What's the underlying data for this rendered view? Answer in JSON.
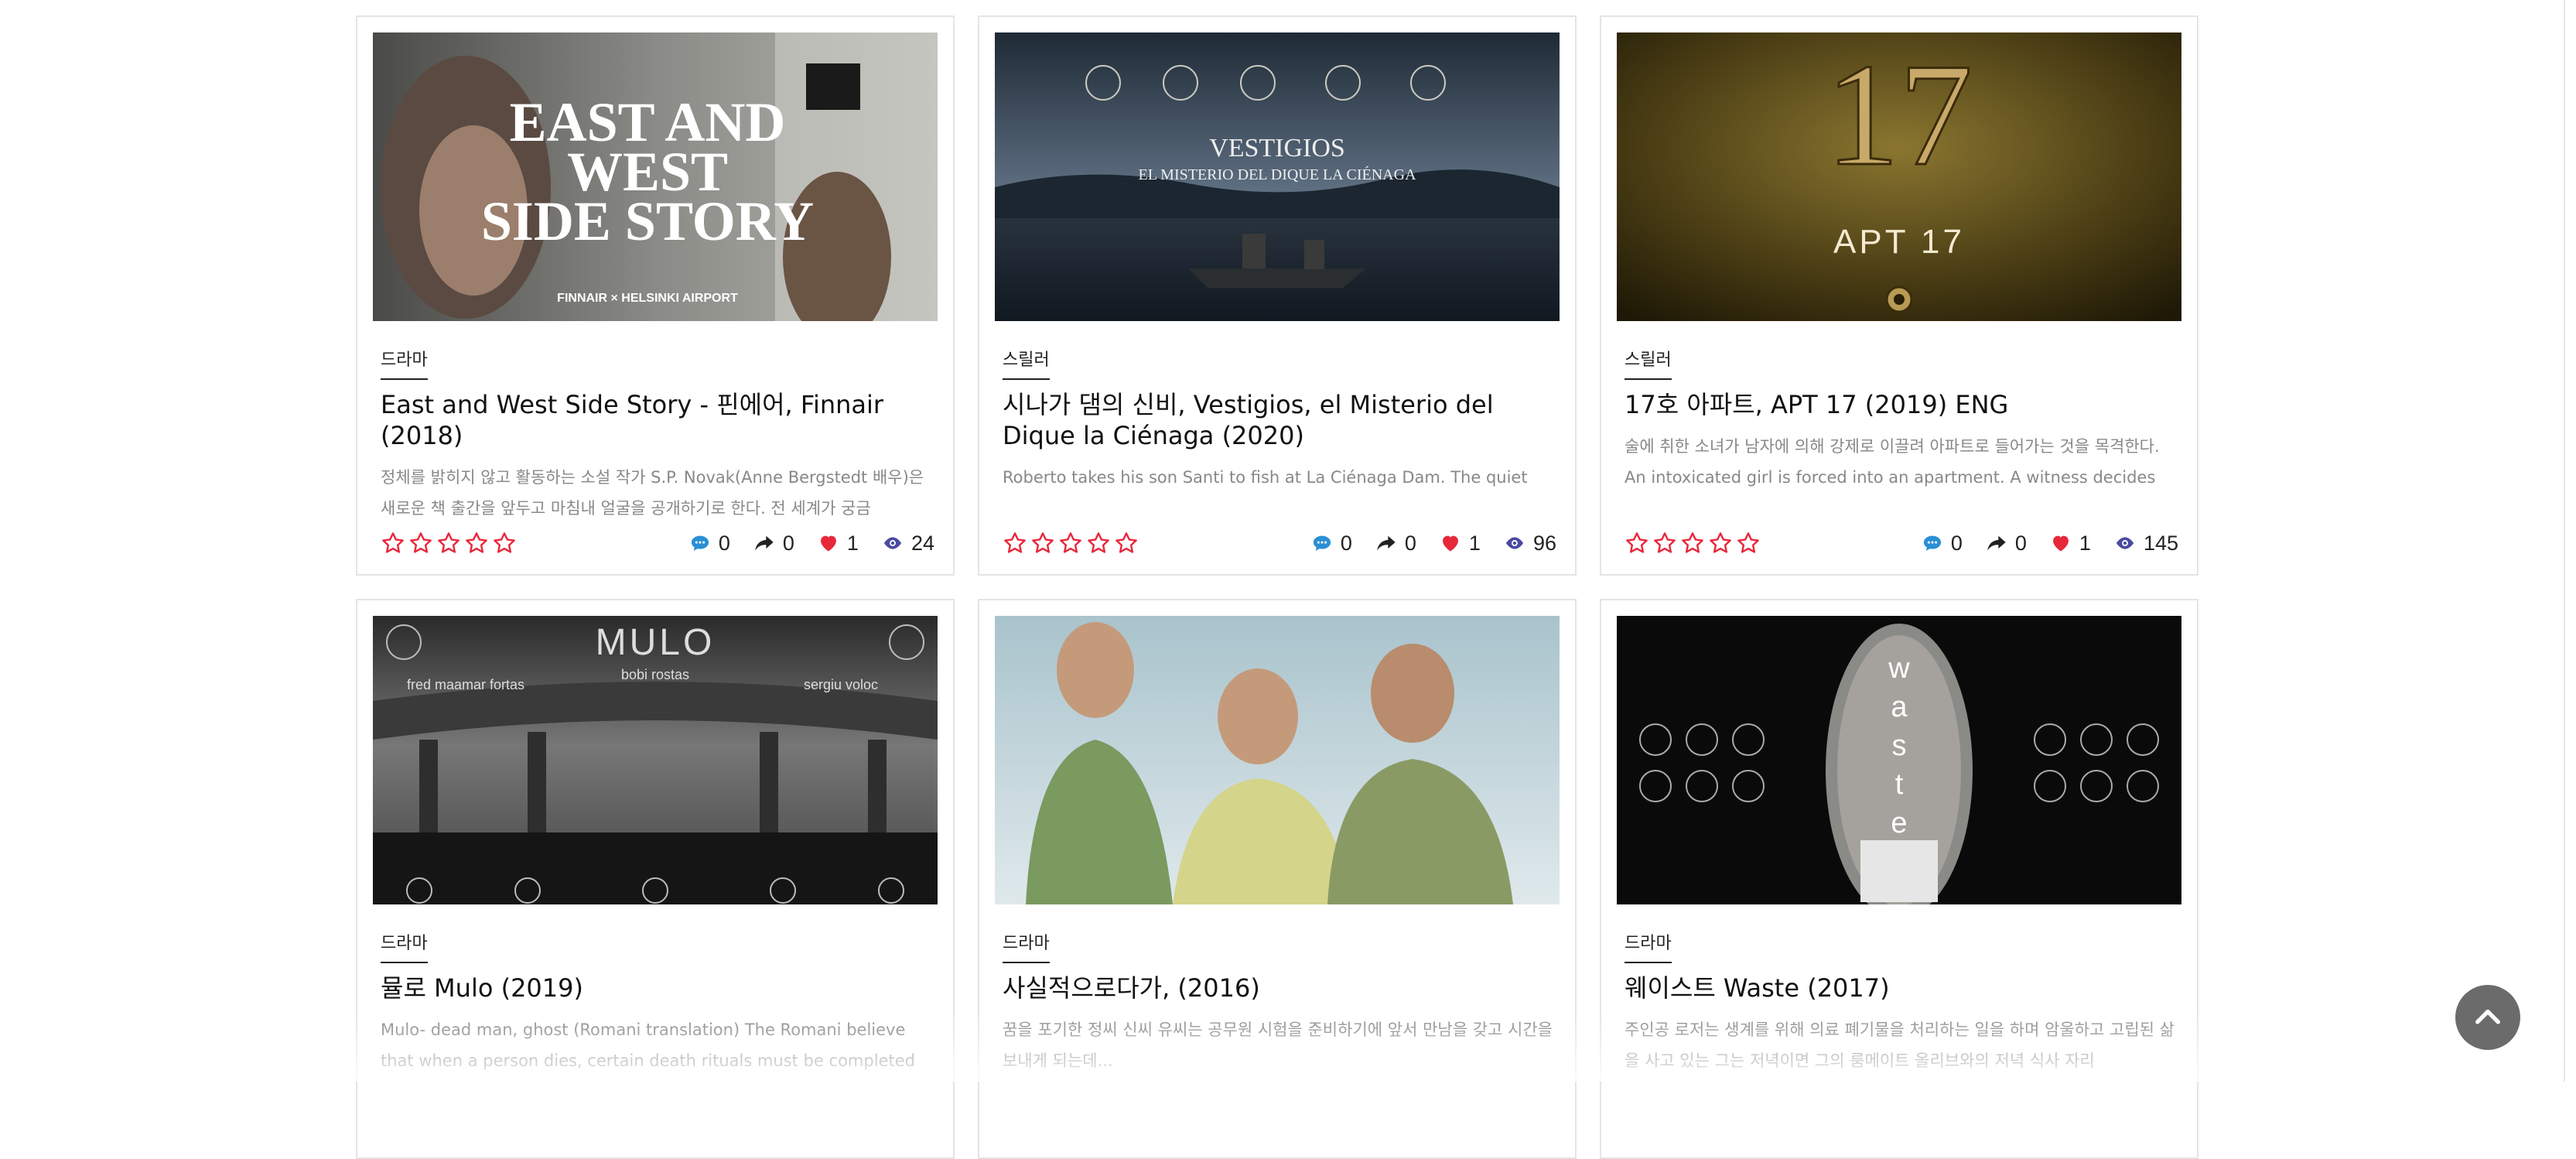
{
  "cards": [
    {
      "genre": "드라마",
      "title": "East and West Side Story - 핀에어, Finnair (2018)",
      "description": "정체를 밝히지 않고 활동하는 소설 작가 S.P. Novak(Anne Bergstedt 배우)은 새로운 책 출간을 앞두고 마침내 얼굴을 공개하기로 한다. 전 세계가 궁금",
      "poster_text": [
        "EAST AND",
        "WEST",
        "SIDE STORY"
      ],
      "poster_caption": "FINNAIR × HELSINKI AIRPORT",
      "comments": "0",
      "shares": "0",
      "likes": "1",
      "views": "24"
    },
    {
      "genre": "스릴러",
      "title": "시나가 댐의 신비, Vestigios, el Misterio del Dique la Ciénaga (2020)",
      "description": "Roberto takes his son Santi to fish at La Ciénaga Dam. The quiet night",
      "poster_text": [
        "VESTIGIOS",
        "EL MISTERIO DEL DIQUE LA CIÉNAGA"
      ],
      "comments": "0",
      "shares": "0",
      "likes": "1",
      "views": "96"
    },
    {
      "genre": "스릴러",
      "title": "17호 아파트, APT 17 (2019) ENG",
      "description": "술에 취한 소녀가 남자에 의해 강제로 이끌려 아파트로 들어가는 것을 목격한다. An intoxicated girl is forced into an apartment. A witness decides",
      "poster_text": [
        "17",
        "APT 17"
      ],
      "comments": "0",
      "shares": "0",
      "likes": "1",
      "views": "145"
    },
    {
      "genre": "드라마",
      "title": "뮬로 Mulo (2019)",
      "description": "Mulo- dead man, ghost (Romani translation) The Romani believe that when a person dies, certain death rituals must be completed and",
      "poster_text": [
        "MULO",
        "bobi rostas",
        "fred maamar fortas",
        "sergiu voloc"
      ]
    },
    {
      "genre": "드라마",
      "title": "사실적으로다가, (2016)",
      "description": "꿈을 포기한 정씨 신씨 유씨는 공무원 시험을 준비하기에 앞서 만남을 갖고 시간을 보내게 되는데..."
    },
    {
      "genre": "드라마",
      "title": "웨이스트 Waste (2017)",
      "description": "주인공 로저는 생계를 위해 의료 폐기물을 처리하는 일을 하며 암울하고 고립된 삶을 사고 있는 그는 저녁이면 그의 룸메이트 올리브와의 저녁 식사 자리",
      "poster_text": [
        "w",
        "a",
        "s",
        "t",
        "e"
      ]
    }
  ],
  "colors": {
    "star": "#e8273a",
    "comment_icon": "#2a8fd6",
    "share_icon": "#222222",
    "heart_icon": "#e8273a",
    "eye_icon": "#4a4aa0"
  },
  "icons": [
    "star-outline-icon",
    "comment-icon",
    "share-icon",
    "heart-icon",
    "eye-icon",
    "chevron-up-icon"
  ]
}
